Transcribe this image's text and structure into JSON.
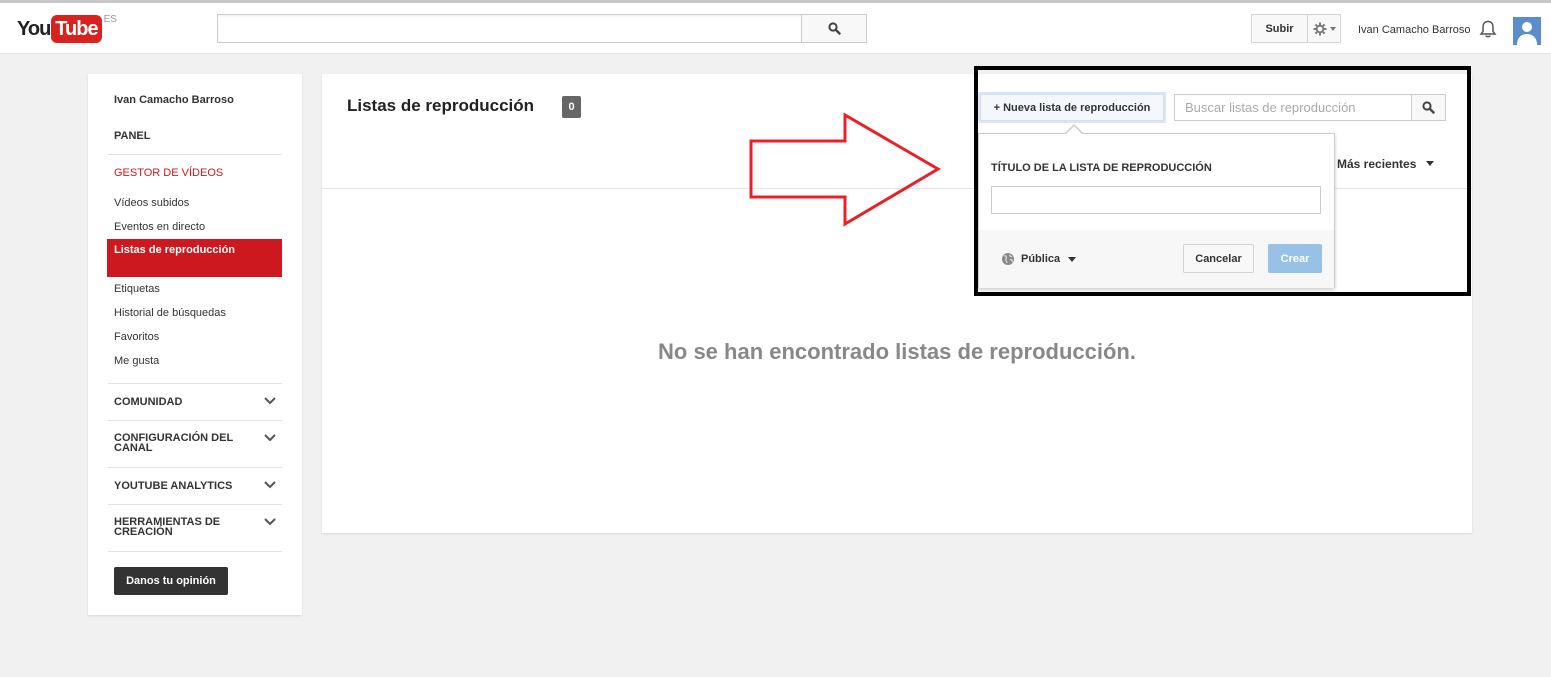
{
  "masthead": {
    "logo_you": "You",
    "logo_tube": "Tube",
    "logo_region": "ES",
    "search_icon": "search-icon",
    "upload_label": "Subir",
    "settings_icon": "gear-icon",
    "username": "Ivan Camacho Barroso",
    "notifications_icon": "bell-icon",
    "avatar_icon": "user-icon"
  },
  "sidebar": {
    "channel_name": "Ivan Camacho Barroso",
    "panel": "PANEL",
    "video_manager": "GESTOR DE VÍDEOS",
    "items": [
      {
        "label": "Vídeos subidos"
      },
      {
        "label": "Eventos en directo"
      },
      {
        "label": "Listas de reproducción",
        "selected": true
      },
      {
        "label": "Etiquetas"
      },
      {
        "label": "Historial de búsquedas"
      },
      {
        "label": "Favoritos"
      },
      {
        "label": "Me gusta"
      }
    ],
    "sections": [
      {
        "label": "COMUNIDAD"
      },
      {
        "label": "CONFIGURACIÓN DEL CANAL"
      },
      {
        "label": "YOUTUBE ANALYTICS"
      },
      {
        "label": "HERRAMIENTAS DE CREACIÓN"
      }
    ],
    "feedback_label": "Danos tu opinión"
  },
  "main": {
    "title": "Listas de reproducción",
    "count": "0",
    "empty_message": "No se han encontrado listas de reproducción.",
    "new_playlist_label": "+ Nueva lista de reproducción",
    "search_placeholder": "Buscar listas de reproducción",
    "sort_label": "Más recientes"
  },
  "popup": {
    "title_label": "TÍTULO DE LA LISTA DE REPRODUCCIÓN",
    "title_value": "",
    "privacy_label": "Pública",
    "privacy_icon": "globe-icon",
    "cancel_label": "Cancelar",
    "create_label": "Crear"
  },
  "colors": {
    "brand_red": "#cc181e",
    "create_disabled": "#98c1e6",
    "annotation_arrow": "#e8202a",
    "annotation_box": "#000000"
  }
}
